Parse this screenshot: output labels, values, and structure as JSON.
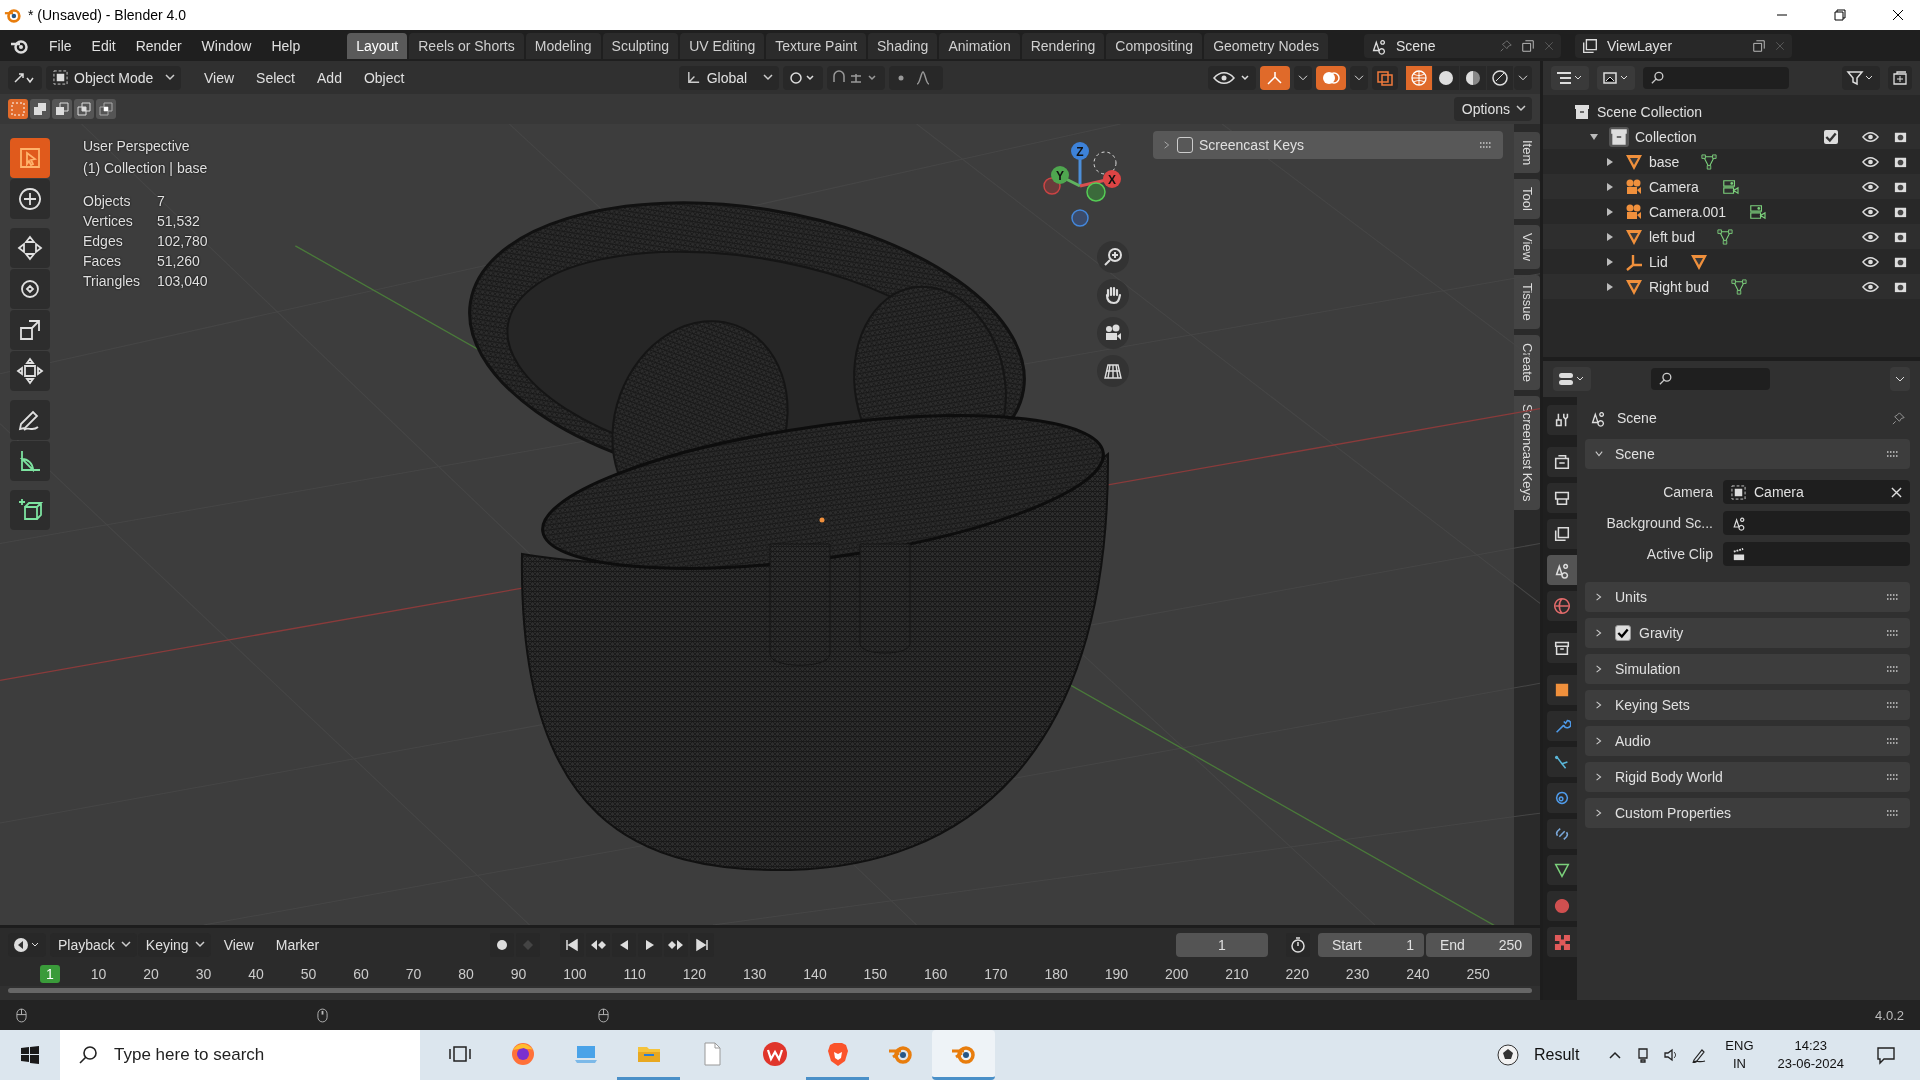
{
  "window": {
    "title": "* (Unsaved) - Blender 4.0"
  },
  "menu": [
    "File",
    "Edit",
    "Render",
    "Window",
    "Help"
  ],
  "workspaces": [
    {
      "label": "Layout",
      "selected": true
    },
    {
      "label": "Reels or Shorts",
      "selected": false
    },
    {
      "label": "Modeling",
      "selected": false
    },
    {
      "label": "Sculpting",
      "selected": false
    },
    {
      "label": "UV Editing",
      "selected": false
    },
    {
      "label": "Texture Paint",
      "selected": false
    },
    {
      "label": "Shading",
      "selected": false
    },
    {
      "label": "Animation",
      "selected": false
    },
    {
      "label": "Rendering",
      "selected": false
    },
    {
      "label": "Compositing",
      "selected": false
    },
    {
      "label": "Geometry Nodes",
      "selected": false
    }
  ],
  "scene": "Scene",
  "view_layer": "ViewLayer",
  "viewport": {
    "mode": "Object Mode",
    "menus": [
      "View",
      "Select",
      "Add",
      "Object"
    ],
    "orientation": "Global",
    "options": "Options",
    "info": [
      "User Perspective",
      "(1) Collection | base"
    ],
    "stats": [
      {
        "label": "Objects",
        "value": "7"
      },
      {
        "label": "Vertices",
        "value": "51,532"
      },
      {
        "label": "Edges",
        "value": "102,780"
      },
      {
        "label": "Faces",
        "value": "51,260"
      },
      {
        "label": "Triangles",
        "value": "103,040"
      }
    ],
    "tools": [
      {
        "kind": "select",
        "selected": true
      },
      {
        "kind": "cursor",
        "selected": false
      },
      {
        "kind": "move",
        "selected": false
      },
      {
        "kind": "rotate",
        "selected": false
      },
      {
        "kind": "scale",
        "selected": false
      },
      {
        "kind": "transform",
        "selected": false
      },
      {
        "kind": "annotate",
        "selected": false
      },
      {
        "kind": "measure",
        "selected": false
      },
      {
        "kind": "add_cube",
        "selected": false
      }
    ],
    "axes": {
      "z": "Z",
      "y": "Y",
      "x": "X"
    },
    "panel": {
      "title": "Screencast Keys",
      "checked": false,
      "expanded": false
    },
    "side_tabs": [
      "Item",
      "Tool",
      "View",
      "Tissue",
      "Create",
      "Screencast Keys"
    ]
  },
  "timeline": {
    "menus": [
      "Playback",
      "Keying",
      "View",
      "Marker"
    ],
    "current": "1",
    "start_label": "Start",
    "start": "1",
    "end_label": "End",
    "end": "250",
    "ruler": [
      {
        "label": "1",
        "selected": true
      },
      {
        "label": "10",
        "selected": false
      },
      {
        "label": "20",
        "selected": false
      },
      {
        "label": "30",
        "selected": false
      },
      {
        "label": "40",
        "selected": false
      },
      {
        "label": "50",
        "selected": false
      },
      {
        "label": "60",
        "selected": false
      },
      {
        "label": "70",
        "selected": false
      },
      {
        "label": "80",
        "selected": false
      },
      {
        "label": "90",
        "selected": false
      },
      {
        "label": "100",
        "selected": false
      },
      {
        "label": "110",
        "selected": false
      },
      {
        "label": "120",
        "selected": false
      },
      {
        "label": "130",
        "selected": false
      },
      {
        "label": "140",
        "selected": false
      },
      {
        "label": "150",
        "selected": false
      },
      {
        "label": "160",
        "selected": false
      },
      {
        "label": "170",
        "selected": false
      },
      {
        "label": "180",
        "selected": false
      },
      {
        "label": "190",
        "selected": false
      },
      {
        "label": "200",
        "selected": false
      },
      {
        "label": "210",
        "selected": false
      },
      {
        "label": "220",
        "selected": false
      },
      {
        "label": "230",
        "selected": false
      },
      {
        "label": "240",
        "selected": false
      },
      {
        "label": "250",
        "selected": false
      }
    ]
  },
  "outliner": {
    "root": "Scene Collection",
    "collection": {
      "name": "Collection",
      "expanded": true,
      "checked": true,
      "children": [
        {
          "name": "base",
          "kind": "mesh",
          "data": {
            "kind": "mesh"
          },
          "expanded": false
        },
        {
          "name": "Camera",
          "kind": "camera",
          "data": {
            "kind": "camera"
          },
          "expanded": false
        },
        {
          "name": "Camera.001",
          "kind": "camera",
          "data": {
            "kind": "camera"
          },
          "expanded": false
        },
        {
          "name": "left bud",
          "kind": "mesh",
          "data": {
            "kind": "mesh"
          },
          "expanded": false
        },
        {
          "name": "Lid",
          "kind": "empty",
          "data": {
            "kind": "object"
          },
          "expanded": false
        },
        {
          "name": "Right bud",
          "kind": "mesh",
          "data": {
            "kind": "mesh"
          },
          "expanded": false
        }
      ]
    }
  },
  "properties": {
    "tabs": [
      {
        "kind": "tool",
        "selected": false
      },
      {
        "kind": "render",
        "selected": false
      },
      {
        "kind": "output",
        "selected": false
      },
      {
        "kind": "view_layer",
        "selected": false
      },
      {
        "kind": "scene",
        "selected": true
      },
      {
        "kind": "world",
        "selected": false
      },
      {
        "kind": "collection",
        "selected": false
      },
      {
        "kind": "object",
        "selected": false
      },
      {
        "kind": "modifiers",
        "selected": false
      },
      {
        "kind": "particles",
        "selected": false
      },
      {
        "kind": "physics",
        "selected": false
      },
      {
        "kind": "constraints",
        "selected": false
      },
      {
        "kind": "data",
        "selected": false
      },
      {
        "kind": "material",
        "selected": false
      },
      {
        "kind": "texture",
        "selected": false
      }
    ],
    "header": "Scene",
    "panels": [
      {
        "title": "Scene",
        "kind": "fields",
        "expanded": true,
        "fields": [
          {
            "label": "Camera",
            "kind": "camera",
            "value": "Camera"
          },
          {
            "label": "Background Sc...",
            "kind": "scene"
          },
          {
            "label": "Active Clip",
            "kind": "clip"
          }
        ]
      },
      {
        "title": "Units",
        "kind": "plain",
        "expanded": false
      },
      {
        "title": "Gravity",
        "kind": "toggle",
        "expanded": false,
        "checked": true
      },
      {
        "title": "Simulation",
        "kind": "plain",
        "expanded": false
      },
      {
        "title": "Keying Sets",
        "kind": "plain",
        "expanded": false
      },
      {
        "title": "Audio",
        "kind": "plain",
        "expanded": false
      },
      {
        "title": "Rigid Body World",
        "kind": "plain",
        "expanded": false
      },
      {
        "title": "Custom Properties",
        "kind": "plain",
        "expanded": false
      }
    ]
  },
  "status": {
    "version": "4.0.2"
  },
  "taskbar": {
    "search": {
      "placeholder": "Type here to search"
    },
    "apps": [
      {
        "kind": "task_view",
        "running": false,
        "selected": false
      },
      {
        "kind": "browser",
        "running": false,
        "selected": false
      },
      {
        "kind": "computer",
        "running": false,
        "selected": false
      },
      {
        "kind": "folder",
        "running": true,
        "selected": false
      },
      {
        "kind": "document",
        "running": false,
        "selected": false
      },
      {
        "kind": "office",
        "running": false,
        "selected": false
      },
      {
        "kind": "shield",
        "running": true,
        "selected": false
      },
      {
        "kind": "blender",
        "running": false,
        "selected": false
      },
      {
        "kind": "blender",
        "running": true,
        "selected": true
      }
    ],
    "weather": "Result",
    "language": [
      "ENG",
      "IN"
    ],
    "time": "14:23",
    "date": "23-06-2024"
  }
}
